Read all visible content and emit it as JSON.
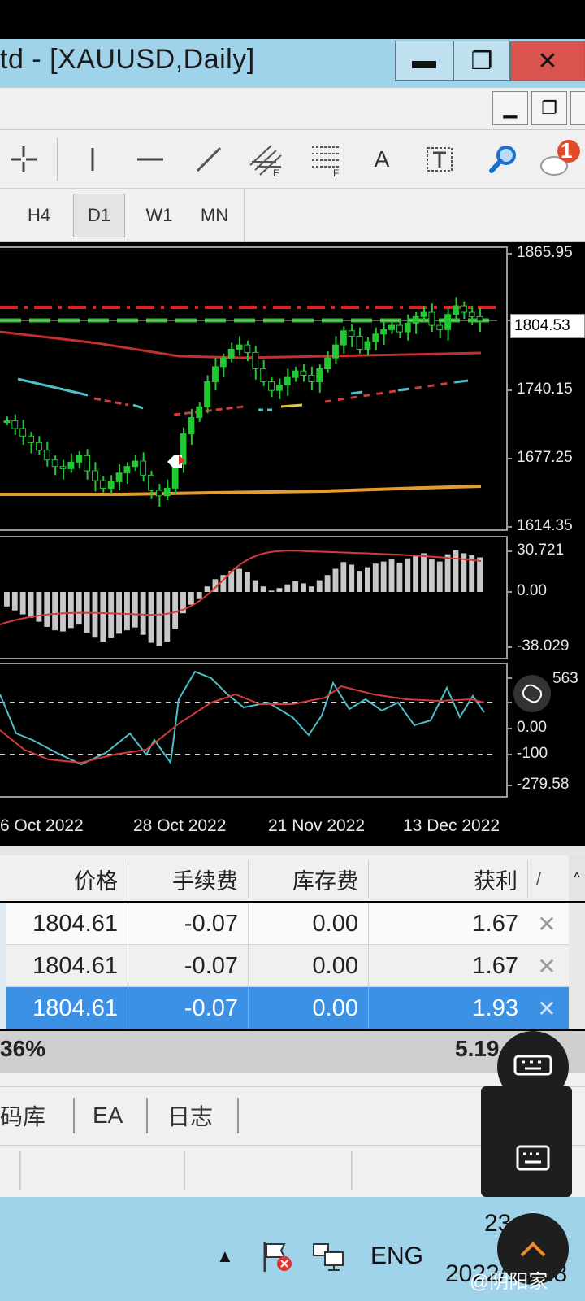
{
  "window": {
    "title": "td - [XAUUSD,Daily]",
    "minimize_icon": "minimize-icon",
    "restore_icon": "restore-icon",
    "close_icon": "close-icon"
  },
  "toolbar": {
    "icons": [
      "crosshair-icon",
      "vertical-line-icon",
      "horizontal-line-icon",
      "trendline-icon",
      "andrews-pitchfork-icon",
      "fibonacci-icon",
      "text-icon",
      "text-label-icon",
      "zoom-icon",
      "notification-icon"
    ],
    "text_tool": "A",
    "notification_badge": "1"
  },
  "timeframes": [
    {
      "label": "H4",
      "active": false
    },
    {
      "label": "D1",
      "active": true
    },
    {
      "label": "W1",
      "active": false
    },
    {
      "label": "MN",
      "active": false
    }
  ],
  "chart": {
    "price_axis": [
      "1865.95",
      "1804.53",
      "1740.15",
      "1677.25",
      "1614.35"
    ],
    "current_price": "1804.53",
    "macd_axis": [
      "30.721",
      "0.00",
      "-38.029"
    ],
    "osc_axis": [
      "563",
      "100",
      "0.00",
      "-100",
      "-279.58"
    ],
    "x_axis": [
      "6 Oct 2022",
      "28 Oct 2022",
      "21 Nov 2022",
      "13 Dec 2022"
    ],
    "colors": {
      "bull": "#22c832",
      "bear": "#ffffff",
      "ma_red": "#d33a3a",
      "ma_orange": "#e69b2e",
      "signal_cyan": "#4cc0c8",
      "resistance": "#e32020",
      "support": "#2cc52c"
    }
  },
  "chart_data": {
    "type": "candlestick",
    "x": [
      "6 Oct 2022",
      "28 Oct 2022",
      "21 Nov 2022",
      "13 Dec 2022"
    ],
    "ylim": [
      1614.35,
      1865.95
    ],
    "series": [
      {
        "values": [
          1712,
          1705,
          1698,
          1692,
          1685,
          1676,
          1670,
          1668,
          1674,
          1680,
          1666,
          1657,
          1650,
          1656,
          1664,
          1670,
          1675,
          1662,
          1648,
          1643,
          1650,
          1672,
          1700,
          1715,
          1725,
          1748,
          1762,
          1770,
          1778,
          1782,
          1775,
          1760,
          1748,
          1740,
          1745,
          1752,
          1758,
          1754,
          1748,
          1760,
          1770,
          1782,
          1795,
          1790,
          1778,
          1785,
          1792,
          1796,
          1800,
          1794,
          1802,
          1808,
          1812,
          1800,
          1796,
          1810,
          1818,
          1812,
          1808,
          1804
        ]
      }
    ],
    "macd": {
      "ylim": [
        -38.029,
        30.721
      ]
    },
    "oscillator": {
      "ylim": [
        -279.58,
        563
      ],
      "levels": [
        100,
        -100
      ]
    }
  },
  "positions": {
    "headers": [
      "价格",
      "手续费",
      "库存费",
      "获利"
    ],
    "rows": [
      {
        "price": "1804.61",
        "commission": "-0.07",
        "swap": "0.00",
        "profit": "1.67"
      },
      {
        "price": "1804.61",
        "commission": "-0.07",
        "swap": "0.00",
        "profit": "1.67"
      },
      {
        "price": "1804.61",
        "commission": "-0.07",
        "swap": "0.00",
        "profit": "1.93"
      }
    ],
    "summary_left": "36%",
    "summary_right": "5.19"
  },
  "bottom_tabs": [
    "码库",
    "EA",
    "日志"
  ],
  "taskbar": {
    "lang": "ENG",
    "time": "23:12",
    "date": "2022/12/28",
    "watermark": "@阴阳家"
  }
}
